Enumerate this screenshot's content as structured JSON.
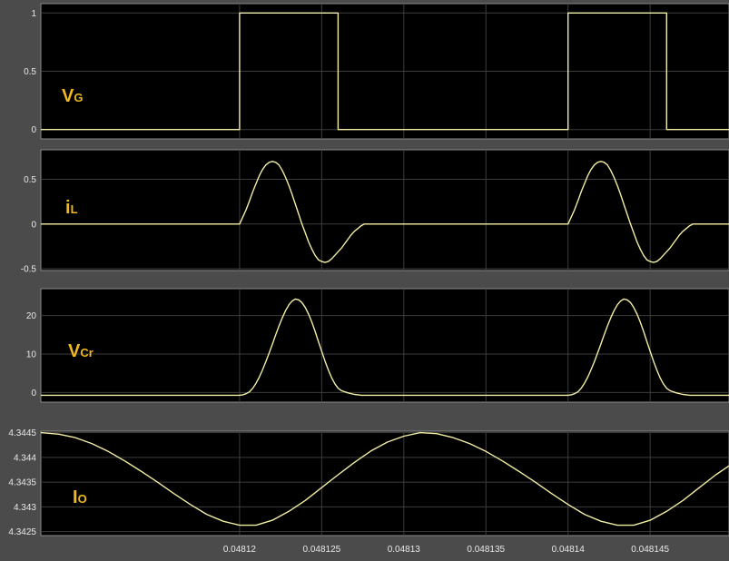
{
  "chart_data": [
    {
      "type": "line",
      "label_main": "V",
      "label_sub": "G",
      "ylim": [
        -0.08,
        1.08
      ],
      "yticks": [
        0,
        0.5,
        1
      ],
      "ytick_labels": [
        "0",
        "0.5",
        "1"
      ],
      "xlim": [
        0.0481079,
        0.0481498
      ],
      "grid": true,
      "line_color": "#f2eda4",
      "series": [
        {
          "x": [
            0.0481079,
            0.04812,
            0.04812,
            0.048126,
            0.048126,
            0.04814,
            0.04814,
            0.048146,
            0.048146,
            0.0481498
          ],
          "y": [
            0,
            0,
            1,
            1,
            0,
            0,
            1,
            1,
            0,
            0
          ]
        }
      ]
    },
    {
      "type": "line",
      "label_main": "i",
      "label_sub": "L",
      "ylim": [
        -0.52,
        0.83
      ],
      "yticks": [
        -0.5,
        0,
        0.5
      ],
      "ytick_labels": [
        "-0.5",
        "0",
        "0.5"
      ],
      "xlim": [
        0.0481079,
        0.0481498
      ],
      "grid": true,
      "line_color": "#f2eda4",
      "series": [
        {
          "x": [
            0.0481079,
            0.04812,
            0.0481202,
            0.0481204,
            0.0481206,
            0.0481208,
            0.048121,
            0.0481212,
            0.0481214,
            0.0481216,
            0.0481218,
            0.048122,
            0.0481222,
            0.0481224,
            0.0481226,
            0.0481228,
            0.048123,
            0.0481232,
            0.0481234,
            0.0481236,
            0.0481238,
            0.048124,
            0.0481242,
            0.0481244,
            0.0481246,
            0.0481248,
            0.048125,
            0.0481252,
            0.0481254,
            0.0481256,
            0.0481258,
            0.048126,
            0.0481262,
            0.0481264,
            0.0481266,
            0.0481268,
            0.048127,
            0.0481272,
            0.0481274,
            0.0481276,
            0.048128,
            0.04814,
            0.0481402,
            0.0481404,
            0.0481406,
            0.0481408,
            0.048141,
            0.0481412,
            0.0481414,
            0.0481416,
            0.0481418,
            0.048142,
            0.0481422,
            0.0481424,
            0.0481426,
            0.0481428,
            0.048143,
            0.0481432,
            0.0481434,
            0.0481436,
            0.0481438,
            0.048144,
            0.0481442,
            0.0481444,
            0.0481446,
            0.0481448,
            0.048145,
            0.0481452,
            0.0481454,
            0.0481456,
            0.0481458,
            0.048146,
            0.0481462,
            0.0481464,
            0.0481466,
            0.0481468,
            0.048147,
            0.0481472,
            0.0481474,
            0.0481476,
            0.0481478,
            0.048148,
            0.0481482,
            0.0481484,
            0.0481486,
            0.0481488,
            0.048149,
            0.0481492,
            0.0481494,
            0.0481496,
            0.0481498
          ],
          "y": [
            0,
            0,
            0.08,
            0.16,
            0.26,
            0.36,
            0.45,
            0.54,
            0.61,
            0.66,
            0.69,
            0.7,
            0.69,
            0.66,
            0.6,
            0.52,
            0.43,
            0.33,
            0.22,
            0.11,
            0,
            -0.1,
            -0.2,
            -0.28,
            -0.35,
            -0.4,
            -0.42,
            -0.43,
            -0.42,
            -0.39,
            -0.35,
            -0.31,
            -0.27,
            -0.22,
            -0.17,
            -0.12,
            -0.08,
            -0.05,
            -0.02,
            0,
            0,
            0,
            0.08,
            0.16,
            0.26,
            0.36,
            0.45,
            0.54,
            0.61,
            0.66,
            0.69,
            0.7,
            0.69,
            0.66,
            0.6,
            0.52,
            0.43,
            0.33,
            0.22,
            0.11,
            0,
            -0.1,
            -0.2,
            -0.28,
            -0.35,
            -0.4,
            -0.42,
            -0.43,
            -0.42,
            -0.39,
            -0.35,
            -0.31,
            -0.27,
            -0.22,
            -0.17,
            -0.12,
            -0.08,
            -0.05,
            -0.02,
            0,
            0,
            0,
            0,
            0,
            0,
            0,
            0,
            0,
            0,
            0,
            0
          ]
        }
      ]
    },
    {
      "type": "line",
      "label_main": "V",
      "label_sub": "Cr",
      "ylim": [
        -2.5,
        27
      ],
      "yticks": [
        0,
        10,
        20
      ],
      "ytick_labels": [
        "0",
        "10",
        "20"
      ],
      "xlim": [
        0.0481079,
        0.0481498
      ],
      "grid": true,
      "line_color": "#f2eda4",
      "series": [
        {
          "x": [
            0.0481079,
            0.04812,
            0.0481202,
            0.0481204,
            0.0481206,
            0.0481208,
            0.048121,
            0.0481212,
            0.0481214,
            0.0481216,
            0.0481218,
            0.048122,
            0.0481222,
            0.0481224,
            0.0481226,
            0.0481228,
            0.048123,
            0.0481232,
            0.0481234,
            0.0481236,
            0.0481238,
            0.048124,
            0.0481242,
            0.0481244,
            0.0481246,
            0.0481248,
            0.048125,
            0.0481252,
            0.0481254,
            0.0481256,
            0.0481258,
            0.048126,
            0.0481262,
            0.0481264,
            0.0481266,
            0.0481268,
            0.048127,
            0.0481272,
            0.0481274,
            0.0481276,
            0.0481278,
            0.048128,
            0.04814,
            0.0481402,
            0.0481404,
            0.0481406,
            0.0481408,
            0.048141,
            0.0481412,
            0.0481414,
            0.0481416,
            0.0481418,
            0.048142,
            0.0481422,
            0.0481424,
            0.0481426,
            0.0481428,
            0.048143,
            0.0481432,
            0.0481434,
            0.0481436,
            0.0481438,
            0.048144,
            0.0481442,
            0.0481444,
            0.0481446,
            0.0481448,
            0.048145,
            0.0481452,
            0.0481454,
            0.0481456,
            0.0481458,
            0.048146,
            0.0481462,
            0.0481464,
            0.0481466,
            0.0481468,
            0.048147,
            0.0481472,
            0.0481474,
            0.0481476,
            0.0481478,
            0.048148,
            0.0481482,
            0.0481484,
            0.0481486,
            0.0481488,
            0.048149,
            0.0481492,
            0.0481494,
            0.0481496,
            0.0481498
          ],
          "y": [
            -0.7,
            -0.7,
            -0.6,
            -0.3,
            0.2,
            1.1,
            2.4,
            4.0,
            5.9,
            8.0,
            10.3,
            12.6,
            15.0,
            17.3,
            19.4,
            21.3,
            22.8,
            23.8,
            24.3,
            24.1,
            23.4,
            22.1,
            20.4,
            18.3,
            15.9,
            13.3,
            10.7,
            8.2,
            5.9,
            3.9,
            2.3,
            1.1,
            0.5,
            0.2,
            -0.1,
            -0.3,
            -0.5,
            -0.6,
            -0.7,
            -0.7,
            -0.7,
            -0.7,
            -0.7,
            -0.6,
            -0.3,
            0.2,
            1.1,
            2.4,
            4.0,
            5.9,
            8.0,
            10.3,
            12.6,
            15.0,
            17.3,
            19.4,
            21.3,
            22.8,
            23.8,
            24.3,
            24.1,
            23.4,
            22.1,
            20.4,
            18.3,
            15.9,
            13.3,
            10.7,
            8.2,
            5.9,
            3.9,
            2.3,
            1.1,
            0.5,
            0.2,
            -0.1,
            -0.3,
            -0.5,
            -0.6,
            -0.7,
            -0.7,
            -0.7,
            -0.7,
            -0.7,
            -0.7,
            -0.7,
            -0.7,
            -0.7,
            -0.7,
            -0.7,
            -0.7,
            -0.7
          ]
        }
      ]
    },
    {
      "type": "line",
      "label_main": "I",
      "label_sub": "O",
      "ylim": [
        4.34242,
        4.34453
      ],
      "yticks": [
        4.3425,
        4.343,
        4.3435,
        4.344,
        4.3445
      ],
      "ytick_labels": [
        "4.3425",
        "4.343",
        "4.3435",
        "4.344",
        "4.3445"
      ],
      "xlim": [
        0.0481079,
        0.0481498
      ],
      "xticks": [
        0.04812,
        0.048125,
        0.04813,
        0.048135,
        0.04814,
        0.048145
      ],
      "xtick_labels": [
        "0.04812",
        "0.048125",
        "0.04813",
        "0.048135",
        "0.04814",
        "0.048145"
      ],
      "grid": true,
      "line_color": "#f2eda4",
      "series": [
        {
          "x": [
            0.0481079,
            0.048109,
            0.04811,
            0.048111,
            0.048112,
            0.048113,
            0.048114,
            0.048115,
            0.048116,
            0.048117,
            0.048118,
            0.048119,
            0.04812,
            0.048121,
            0.048122,
            0.048123,
            0.048124,
            0.048125,
            0.048126,
            0.048127,
            0.048128,
            0.048129,
            0.04813,
            0.048131,
            0.048132,
            0.048133,
            0.048134,
            0.048135,
            0.048136,
            0.048137,
            0.048138,
            0.048139,
            0.04814,
            0.048141,
            0.048142,
            0.048143,
            0.048144,
            0.048145,
            0.048146,
            0.048147,
            0.048148,
            0.048149,
            0.0481498
          ],
          "y": [
            4.3445,
            4.34447,
            4.3444,
            4.34428,
            4.34412,
            4.34393,
            4.34372,
            4.3435,
            4.34327,
            4.34305,
            4.34285,
            4.34271,
            4.34263,
            4.34263,
            4.34273,
            4.34291,
            4.34313,
            4.34339,
            4.34365,
            4.3439,
            4.34413,
            4.34431,
            4.34443,
            4.3445,
            4.34448,
            4.3444,
            4.34428,
            4.34412,
            4.34393,
            4.34372,
            4.3435,
            4.34327,
            4.34305,
            4.34285,
            4.34271,
            4.34263,
            4.34263,
            4.34273,
            4.34291,
            4.34313,
            4.34339,
            4.34365,
            4.34383
          ]
        }
      ]
    }
  ]
}
